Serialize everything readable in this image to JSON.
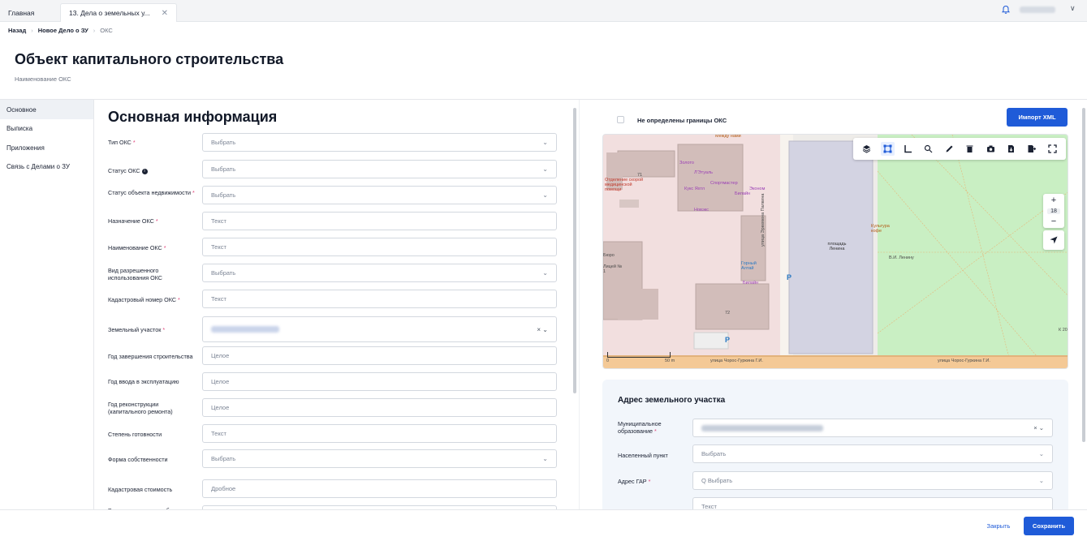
{
  "tabs": [
    {
      "label": "Главная"
    },
    {
      "label": "13. Дела о земельных у...",
      "close": "✕"
    }
  ],
  "header": {
    "chevron": "∨"
  },
  "breadcrumb": {
    "back": "Назад",
    "parent": "Новое Дело о ЗУ",
    "current": "ОКС",
    "sep": "›"
  },
  "page": {
    "title": "Объект капитального строительства",
    "subtitle": "Наименование ОКС"
  },
  "sidebar": {
    "items": [
      {
        "label": "Основное"
      },
      {
        "label": "Выписка"
      },
      {
        "label": "Приложения"
      },
      {
        "label": "Связь с Делами о ЗУ"
      }
    ]
  },
  "form": {
    "section_title": "Основная информация",
    "req_mark": "*",
    "info_mark": "i",
    "fields": [
      {
        "label": "Тип ОКС",
        "value": "Выбрать",
        "chevron": "⌄"
      },
      {
        "label": "Статус ОКС",
        "value": "Выбрать",
        "chevron": "⌄"
      },
      {
        "label": "Статус объекта недвижимости",
        "value": "Выбрать",
        "chevron": "⌄"
      },
      {
        "label": "Назначение ОКС",
        "placeholder": "Текст"
      },
      {
        "label": "Наименование ОКС",
        "placeholder": "Текст"
      },
      {
        "label": "Вид разрешенного использования ОКС",
        "value": "Выбрать",
        "chevron": "⌄"
      },
      {
        "label": "Кадастровый номер ОКС",
        "placeholder": "Текст"
      },
      {
        "label": "Земельный участок",
        "controls": "× ⌄"
      },
      {
        "label": "Год завершения строительства",
        "placeholder": "Целое"
      },
      {
        "label": "Год ввода в эксплуатацию",
        "placeholder": "Целое"
      },
      {
        "label": "Год реконструкции (капитального ремонта)",
        "placeholder": "Целое"
      },
      {
        "label": "Степень готовности",
        "placeholder": "Текст"
      },
      {
        "label": "Форма собственности",
        "value": "Выбрать",
        "chevron": "⌄"
      },
      {
        "label": "Кадастровая стоимость",
        "placeholder": "Дробное"
      },
      {
        "label": "Вид выполняемых работ в"
      }
    ]
  },
  "right": {
    "checkbox_label": "Не определены границы ОКС",
    "import_button": "Импорт XML"
  },
  "map": {
    "zoom_level": "18",
    "zoom_in": "+",
    "zoom_out": "−",
    "scale_left": "0",
    "scale_right": "50 m",
    "labels": {
      "mezhdu": "Между нами",
      "otdelenie": "Отделение скорой медицинской помощи",
      "zoloto": "Золото",
      "letual": "Л'Этуаль",
      "sportmaster": "Спортмастер",
      "ekonom": "Эконом",
      "kuks": "Кукс Яхтл",
      "bilain1": "Билайн",
      "novex": "Новэкс",
      "gorny": "Горный Алтай",
      "bilain2": "Билайн",
      "biro": "Бюро",
      "kulturakofe": "Культура кофе",
      "lenin": "В.И. Ленину",
      "ploshad": "площадь Ленина",
      "papina": "улица Эркемена Палкина",
      "choros1": "улица Чорос-Гуркина Г.И.",
      "choros2": "улица Чорос-Гуркина Г.И.",
      "num71": "71",
      "num72": "72",
      "k20": "К 20",
      "p1": "P",
      "p2": "P",
      "lyceum": "Лицей № 1"
    }
  },
  "address": {
    "title": "Адрес земельного участка",
    "fields": [
      {
        "label": "Муниципальное образование",
        "controls": "× ⌄"
      },
      {
        "label": "Населенный пункт",
        "value": "Выбрать",
        "chevron": "⌄"
      },
      {
        "label": "Адрес ГАР",
        "value": "Q Выбрать",
        "chevron": "⌄"
      },
      {
        "placeholder": "Текст"
      }
    ]
  },
  "footer": {
    "close": "Закрыть",
    "save": "Сохранить"
  },
  "colors": {
    "accent": "#1f5bd8",
    "required": "#e0457b"
  }
}
